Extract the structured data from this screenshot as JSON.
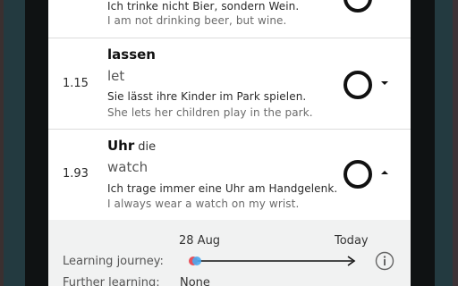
{
  "entries": [
    {
      "score": "",
      "word": "",
      "article": "",
      "translation": "",
      "example_de": "Ich trinke nicht Bier, sondern Wein.",
      "example_en": "I am not drinking beer, but wine."
    },
    {
      "score": "1.15",
      "word": "lassen",
      "article": "",
      "translation": "let",
      "example_de": "Sie lässt ihre Kinder im Park spielen.",
      "example_en": "She lets her children play in the park.",
      "expanded": false
    },
    {
      "score": "1.93",
      "word": "Uhr",
      "article": "die",
      "translation": "watch",
      "example_de": "Ich trage immer eine Uhr am Handgelenk.",
      "example_en": "I always wear a watch on my wrist.",
      "expanded": true
    }
  ],
  "journey": {
    "start_date": "28 Aug",
    "end_date": "Today",
    "learning_journey_label": "Learning journey:",
    "further_learning_label": "Further learning:",
    "further_learning_value": "None"
  },
  "colors": {
    "background": "#233a40",
    "dot_red": "#e8505a",
    "dot_blue": "#4aa8f0"
  },
  "icons": [
    "circle-status-icon",
    "caret-down-icon",
    "caret-up-icon",
    "info-icon",
    "arrow-right-icon"
  ]
}
